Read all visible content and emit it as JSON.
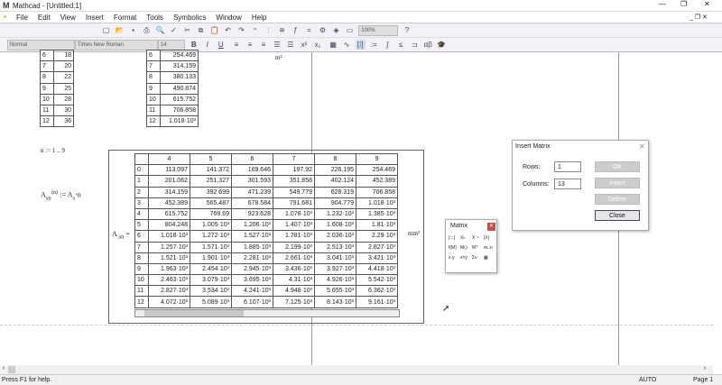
{
  "window": {
    "title": "Mathcad - [Untitled:1]",
    "logo": "M"
  },
  "menu": [
    "File",
    "Edit",
    "View",
    "Insert",
    "Format",
    "Tools",
    "Symbolics",
    "Window",
    "Help"
  ],
  "toolbar": {
    "zoom": "100%",
    "style": "Normal",
    "font": "Times New Roman",
    "size": "14",
    "bold": "B",
    "italic": "I",
    "underline": "U"
  },
  "left_table": {
    "rows": [
      [
        "6",
        "18"
      ],
      [
        "7",
        "20"
      ],
      [
        "8",
        "22"
      ],
      [
        "9",
        "25"
      ],
      [
        "10",
        "28"
      ],
      [
        "11",
        "30"
      ],
      [
        "12",
        "36"
      ]
    ]
  },
  "right_table": {
    "rows": [
      [
        "6",
        "254.469"
      ],
      [
        "7",
        "314.159"
      ],
      [
        "8",
        "380.133"
      ],
      [
        "9",
        "490.874"
      ],
      [
        "10",
        "615.752"
      ],
      [
        "11",
        "706.858"
      ],
      [
        "12",
        "1.018·10³"
      ]
    ]
  },
  "unit_top": "m²",
  "range_def": "n := 1 .. 9",
  "assign_def": {
    "lhs": "A",
    "lhs_sub": "sn",
    "lhs_sup": "⟨n⟩",
    "op": ":=",
    "rhs": "A",
    "rhs_sub": "s",
    "rhs_tail": "·n"
  },
  "result": {
    "label": "A",
    "label_sub": ".sn",
    "eq": "=",
    "unit": "mm²",
    "columns": [
      "4",
      "5",
      "6",
      "7",
      "8",
      "9"
    ],
    "rows": [
      [
        "0",
        "113.097",
        "141.372",
        "169.646",
        "197.92",
        "226.195",
        "254.469"
      ],
      [
        "1",
        "201.062",
        "251.327",
        "301.593",
        "351.858",
        "402.124",
        "452.389"
      ],
      [
        "2",
        "314.159",
        "392.699",
        "471.239",
        "549.779",
        "628.319",
        "706.858"
      ],
      [
        "3",
        "452.389",
        "565.487",
        "678.584",
        "791.681",
        "904.779",
        "1.018·10³"
      ],
      [
        "4",
        "615.752",
        "769.69",
        "923.628",
        "1.078·10³",
        "1.232·10³",
        "1.385·10³"
      ],
      [
        "5",
        "804.248",
        "1.005·10³",
        "1.206·10³",
        "1.407·10³",
        "1.608·10³",
        "1.81·10³"
      ],
      [
        "6",
        "1.018·10³",
        "1.272·10³",
        "1.527·10³",
        "1.781·10³",
        "2.036·10³",
        "2.29·10³"
      ],
      [
        "7",
        "1.257·10³",
        "1.571·10³",
        "1.885·10³",
        "2.199·10³",
        "2.513·10³",
        "2.827·10³"
      ],
      [
        "8",
        "1.521·10³",
        "1.901·10³",
        "2.281·10³",
        "2.661·10³",
        "3.041·10³",
        "3.421·10³"
      ],
      [
        "9",
        "1.963·10³",
        "2.454·10³",
        "2.945·10³",
        "3.436·10³",
        "3.927·10³",
        "4.418·10³"
      ],
      [
        "10",
        "2.463·10³",
        "3.079·10³",
        "3.695·10³",
        "4.31·10³",
        "4.926·10³",
        "5.542·10³"
      ],
      [
        "11",
        "2.827·10³",
        "3.534·10³",
        "4.241·10³",
        "4.948·10³",
        "5.655·10³",
        "6.362·10³"
      ],
      [
        "12",
        "4.072·10³",
        "5.089·10³",
        "6.107·10³",
        "7.125·10³",
        "8.143·10³",
        "9.161·10³"
      ]
    ]
  },
  "matrix_palette": {
    "title": "Matrix",
    "icons": [
      "[:::]",
      "Xₙ",
      "X⁻¹",
      "|X|",
      "f(M)",
      "M⟨⟩",
      "Mᵀ",
      "m..n",
      "x·y",
      "x×y",
      "Σv",
      "▦"
    ]
  },
  "insert_matrix": {
    "title": "Insert Matrix",
    "rows_label": "Rows:",
    "rows_value": "1",
    "cols_label": "Columns:",
    "cols_value": "13",
    "ok": "OK",
    "insert": "Insert",
    "delete": "Delete",
    "close": "Close"
  },
  "status": {
    "help": "Press F1 for help.",
    "mode": "AUTO",
    "page": "Page 1"
  }
}
